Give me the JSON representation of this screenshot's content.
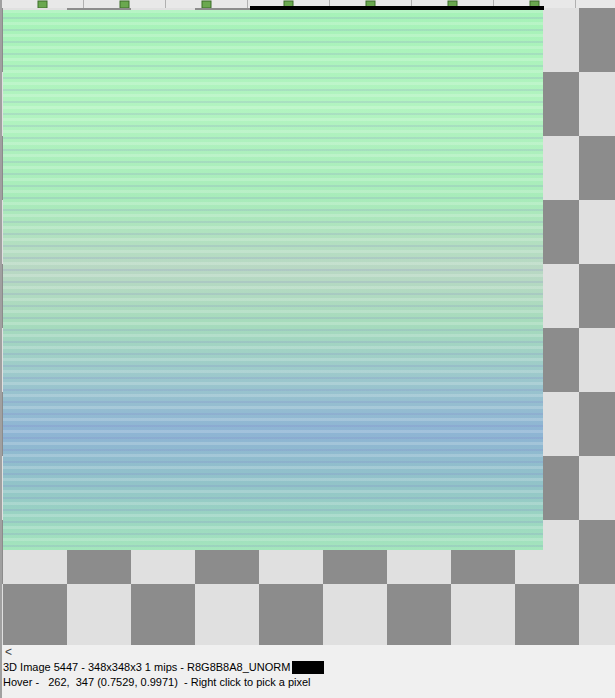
{
  "scrollbar": {
    "arrow": "<"
  },
  "status_bar": {
    "image_info": "3D Image 5447 - 348x348x3 1 mips - R8G8B8A8_UNORM",
    "picked_color": "#000000",
    "hover": "Hover -   262,  347 (0.7529, 0.9971)  - Right click to pick a pixel"
  }
}
